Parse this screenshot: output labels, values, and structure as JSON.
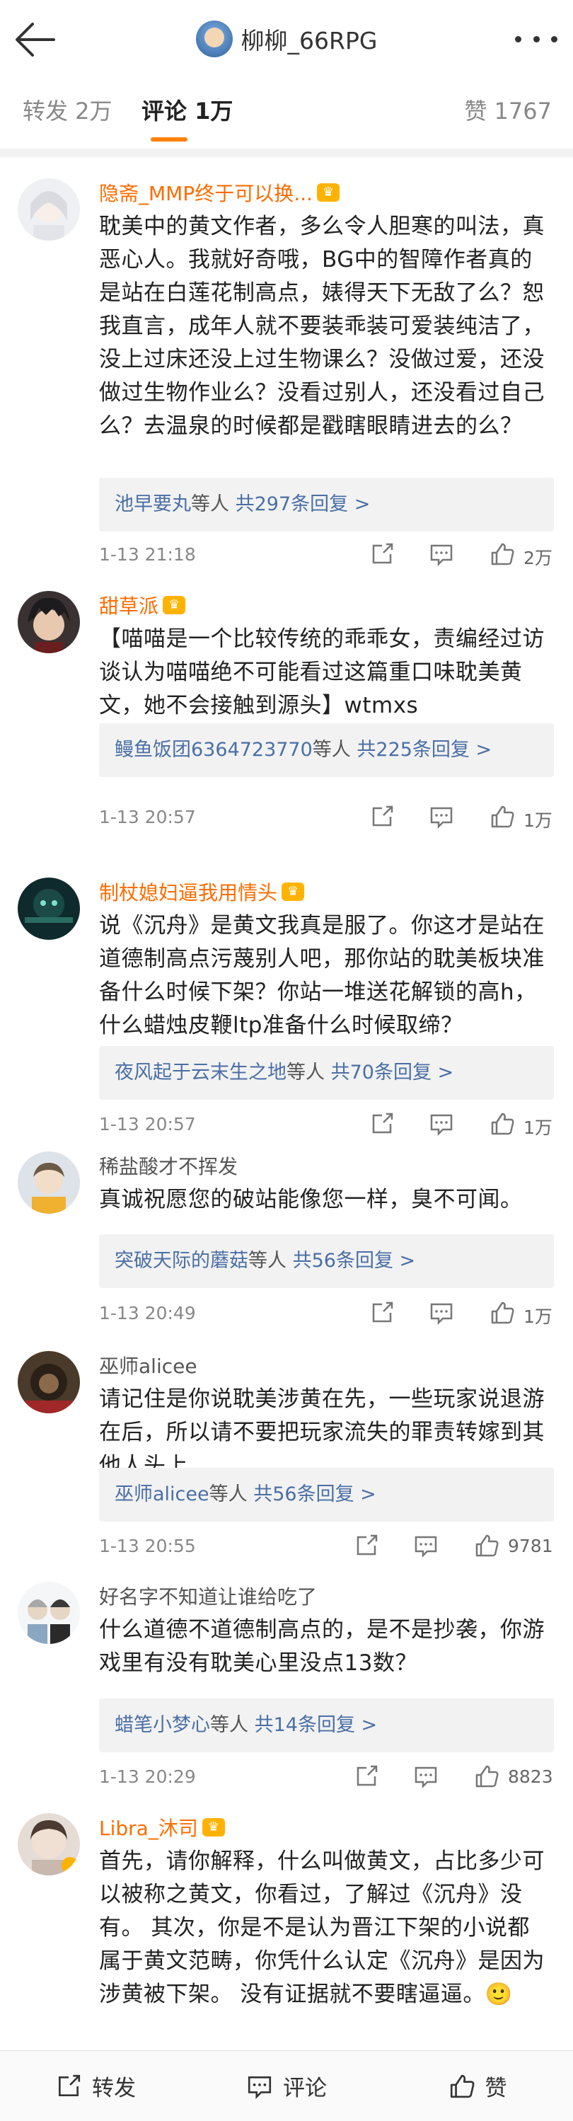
{
  "header": {
    "title": "柳柳_66RPG",
    "back_icon": "arrow-left-icon",
    "more_icon": "more-dots-icon"
  },
  "tabs": {
    "repost": "转发 2万",
    "comments": "评论 1万",
    "likes": "赞 1767",
    "accent": "#ff8200"
  },
  "comments": [
    {
      "name": "隐斋_MMP终于可以换...",
      "vip": true,
      "text": "耽美中的黄文作者，多么令人胆寒的叫法，真恶心人。我就好奇哦，BG中的智障作者真的是站在白莲花制高点，婊得天下无敌了么？恕我直言，成年人就不要装乖装可爱装纯洁了，没上过床还没上过生物课么？没做过爱，还没做过生物作业么？没看过别人，还没看过自己么？去温泉的时候都是戳瞎眼睛进去的么？",
      "reply_who": "池早要丸",
      "reply_mid": "等人 ",
      "reply_count": "共297条回复 >",
      "time": "1-13 21:18",
      "likes": "2万"
    },
    {
      "name": "甜草派",
      "vip": true,
      "text": "【喵喵是一个比较传统的乖乖女，责编经过访谈认为喵喵绝不可能看过这篇重口味耽美黄文，她不会接触到源头】wtmxs",
      "reply_who": "鳗鱼饭团6364723770",
      "reply_mid": "等人 ",
      "reply_count": "共225条回复 >",
      "time": "1-13 20:57",
      "likes": "1万"
    },
    {
      "name": "制杖媳妇逼我用情头",
      "vip": true,
      "text": "说《沉舟》是黄文我真是服了。你这才是站在道德制高点污蔑别人吧，那你站的耽美板块准备什么时候下架？你站一堆送花解锁的高h，什么蜡烛皮鞭ltp准备什么时候取缔？",
      "reply_who": "夜风起于云末生之地",
      "reply_mid": "等人 ",
      "reply_count": "共70条回复 >",
      "time": "1-13 20:57",
      "likes": "1万"
    },
    {
      "name": "稀盐酸才不挥发",
      "vip": false,
      "text": "真诚祝愿您的破站能像您一样，臭不可闻。",
      "reply_who": "突破天际的蘑菇",
      "reply_mid": "等人 ",
      "reply_count": "共56条回复 >",
      "time": "1-13 20:49",
      "likes": "1万"
    },
    {
      "name": "巫师alicee",
      "vip": false,
      "text": "请记住是你说耽美涉黄在先，一些玩家说退游在后，所以请不要把玩家流失的罪责转嫁到其他人头上",
      "reply_who": "巫师alicee",
      "reply_mid": "等人 ",
      "reply_count": "共56条回复 >",
      "time": "1-13 20:55",
      "likes": "9781"
    },
    {
      "name": "好名字不知道让谁给吃了",
      "vip": false,
      "text": "什么道德不道德制高点的，是不是抄袭，你游戏里有没有耽美心里没点13数？",
      "reply_who": "蜡笔小梦心",
      "reply_mid": "等人 ",
      "reply_count": "共14条回复 >",
      "time": "1-13 20:29",
      "likes": "8823"
    },
    {
      "name": "Libra_沐司",
      "vip": true,
      "text": "首先，请你解释，什么叫做黄文，占比多少可以被称之黄文，你看过，了解过《沉舟》没有。 其次，你是不是认为晋江下架的小说都属于黄文范畴，你凭什么认定《沉舟》是因为涉黄被下架。 没有证据就不要瞎逼逼。🙂"
    }
  ],
  "bottom_bar": {
    "repost": "转发",
    "comment": "评论",
    "like": "赞"
  }
}
